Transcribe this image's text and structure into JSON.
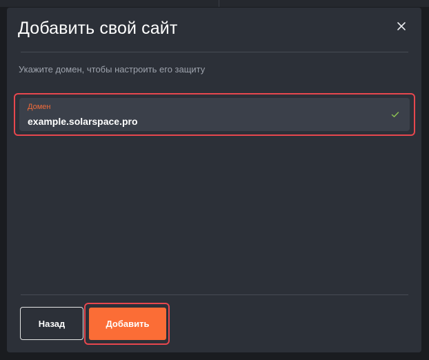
{
  "modal": {
    "title": "Добавить свой сайт",
    "subtitle": "Укажите домен, чтобы настроить его защиту"
  },
  "domain_field": {
    "label": "Домен",
    "value": "example.solarspace.pro",
    "valid": true
  },
  "buttons": {
    "back_label": "Назад",
    "add_label": "Добавить"
  },
  "icons": {
    "close": "close-icon",
    "check": "check-icon"
  },
  "colors": {
    "accent": "#fb6d36",
    "highlight": "#e8474e",
    "label": "#f26b3a",
    "check": "#8cc152",
    "modal_bg": "#2c3038",
    "field_bg": "#3b404a"
  }
}
